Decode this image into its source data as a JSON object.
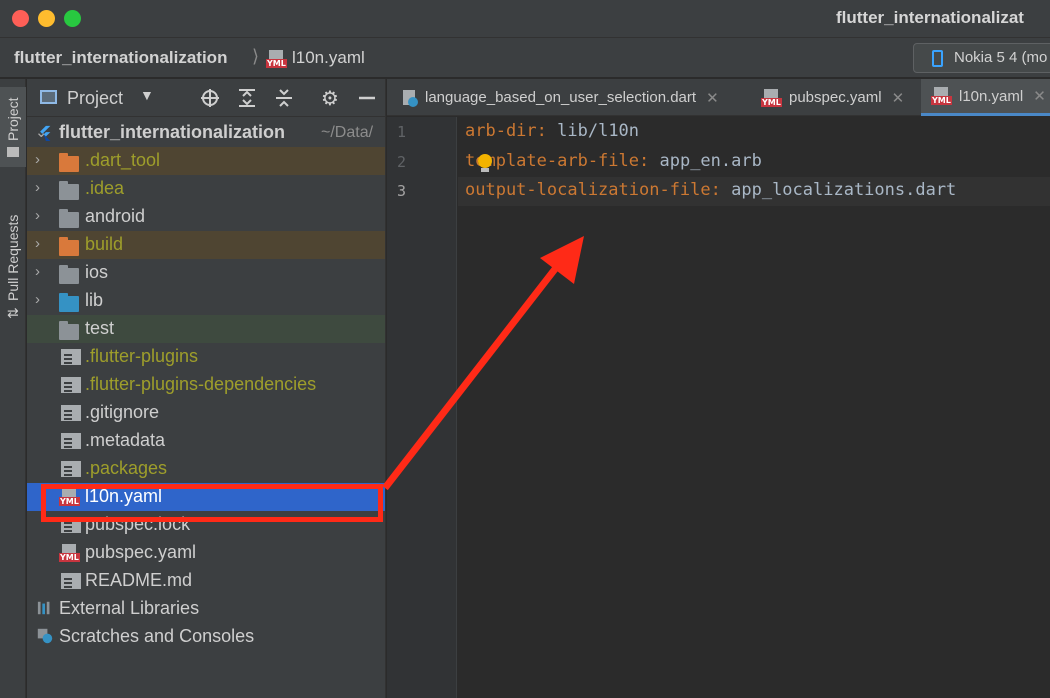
{
  "window": {
    "title": "flutter_internationalizat"
  },
  "breadcrumb": {
    "project": "flutter_internationalization",
    "separator": "⟩",
    "file": "l10n.yaml"
  },
  "device_selector": {
    "label": "Nokia 5 4 (mo"
  },
  "left_strip": {
    "project_tab": "Project",
    "pull_requests_tab": "Pull Requests"
  },
  "project_panel": {
    "title": "Project",
    "root": {
      "name": "flutter_internationalization",
      "path": "~/Data/"
    },
    "items": [
      {
        "label": ".dart_tool",
        "icon": "folder-orange",
        "expandable": true
      },
      {
        "label": ".idea",
        "icon": "folder-gear",
        "expandable": true
      },
      {
        "label": "android",
        "icon": "folder-android",
        "expandable": true
      },
      {
        "label": "build",
        "icon": "folder-build",
        "expandable": true
      },
      {
        "label": "ios",
        "icon": "folder-ios",
        "expandable": true
      },
      {
        "label": "lib",
        "icon": "folder-source",
        "expandable": true
      },
      {
        "label": "test",
        "icon": "folder-test",
        "expandable": false
      },
      {
        "label": ".flutter-plugins",
        "icon": "file",
        "expandable": false
      },
      {
        "label": ".flutter-plugins-dependencies",
        "icon": "file",
        "expandable": false
      },
      {
        "label": ".gitignore",
        "icon": "file-ignored",
        "expandable": false
      },
      {
        "label": ".metadata",
        "icon": "file",
        "expandable": false
      },
      {
        "label": ".packages",
        "icon": "file",
        "expandable": false
      },
      {
        "label": "l10n.yaml",
        "icon": "yaml-file",
        "expandable": false,
        "selected": true
      },
      {
        "label": "pubspec.lock",
        "icon": "file",
        "expandable": false
      },
      {
        "label": "pubspec.yaml",
        "icon": "yaml-file",
        "expandable": false
      },
      {
        "label": "README.md",
        "icon": "file",
        "expandable": false
      }
    ],
    "external_libraries": "External Libraries",
    "scratches": "Scratches and Consoles"
  },
  "editor_tabs": [
    {
      "label": "language_based_on_user_selection.dart",
      "close": "✕"
    },
    {
      "label": "pubspec.yaml",
      "close": "✕"
    },
    {
      "label": "l10n.yaml",
      "close": "✕",
      "active": true
    }
  ],
  "editor": {
    "line_numbers": [
      "1",
      "2",
      "3"
    ],
    "lines": [
      {
        "key": "arb-dir",
        "sep": ":",
        "value": " lib/l10n"
      },
      {
        "key": "template-arb-file",
        "sep": ":",
        "value": " app_en.arb"
      },
      {
        "key": "output-localization-file",
        "sep": ":",
        "value": " app_localizations.dart"
      }
    ]
  },
  "colors": {
    "accent_selection": "#2f65ca",
    "annotation_red": "#ff2a17",
    "yaml_key": "#cc7832",
    "yaml_value": "#a9b7c6"
  }
}
